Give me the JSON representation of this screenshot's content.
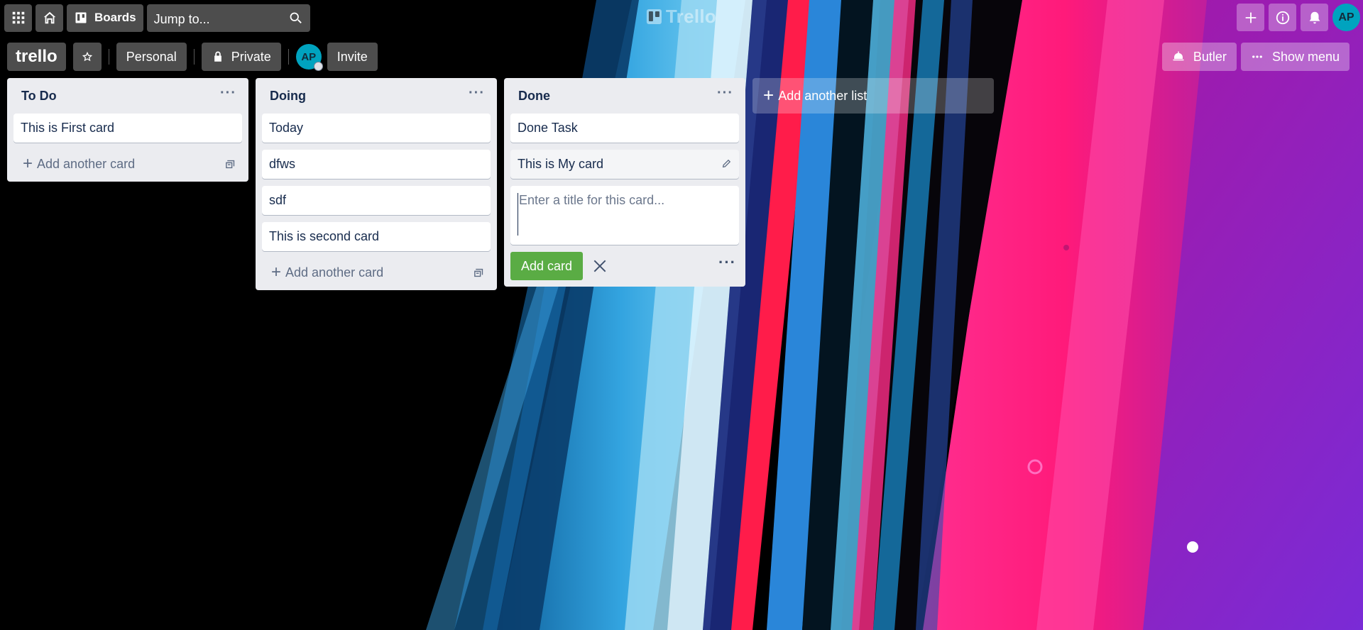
{
  "header": {
    "apps_icon": "grid-icon",
    "home_icon": "home-icon",
    "boards_label": "Boards",
    "search_placeholder": "Jump to...",
    "logo_text": "Trello",
    "avatar_initials": "AP"
  },
  "board": {
    "title": "trello",
    "team_label": "Personal",
    "visibility_label": "Private",
    "member_initials": "AP",
    "invite_label": "Invite",
    "butler_label": "Butler",
    "menu_label": "Show menu"
  },
  "lists": [
    {
      "title": "To Do",
      "cards": [
        "This is First card"
      ],
      "add_card_label": "Add another card"
    },
    {
      "title": "Doing",
      "cards": [
        "Today",
        "dfws",
        "sdf",
        "This is second card"
      ],
      "add_card_label": "Add another card"
    },
    {
      "title": "Done",
      "cards": [
        "Done Task",
        "This is My card"
      ],
      "composer": {
        "placeholder": "Enter a title for this card...",
        "submit_label": "Add card"
      }
    }
  ],
  "add_list_label": "Add another list",
  "colors": {
    "add_card_green": "#5aac44",
    "list_bg": "#ebecf0",
    "avatar_teal": "#00a3bf",
    "text_primary": "#172b4d"
  }
}
